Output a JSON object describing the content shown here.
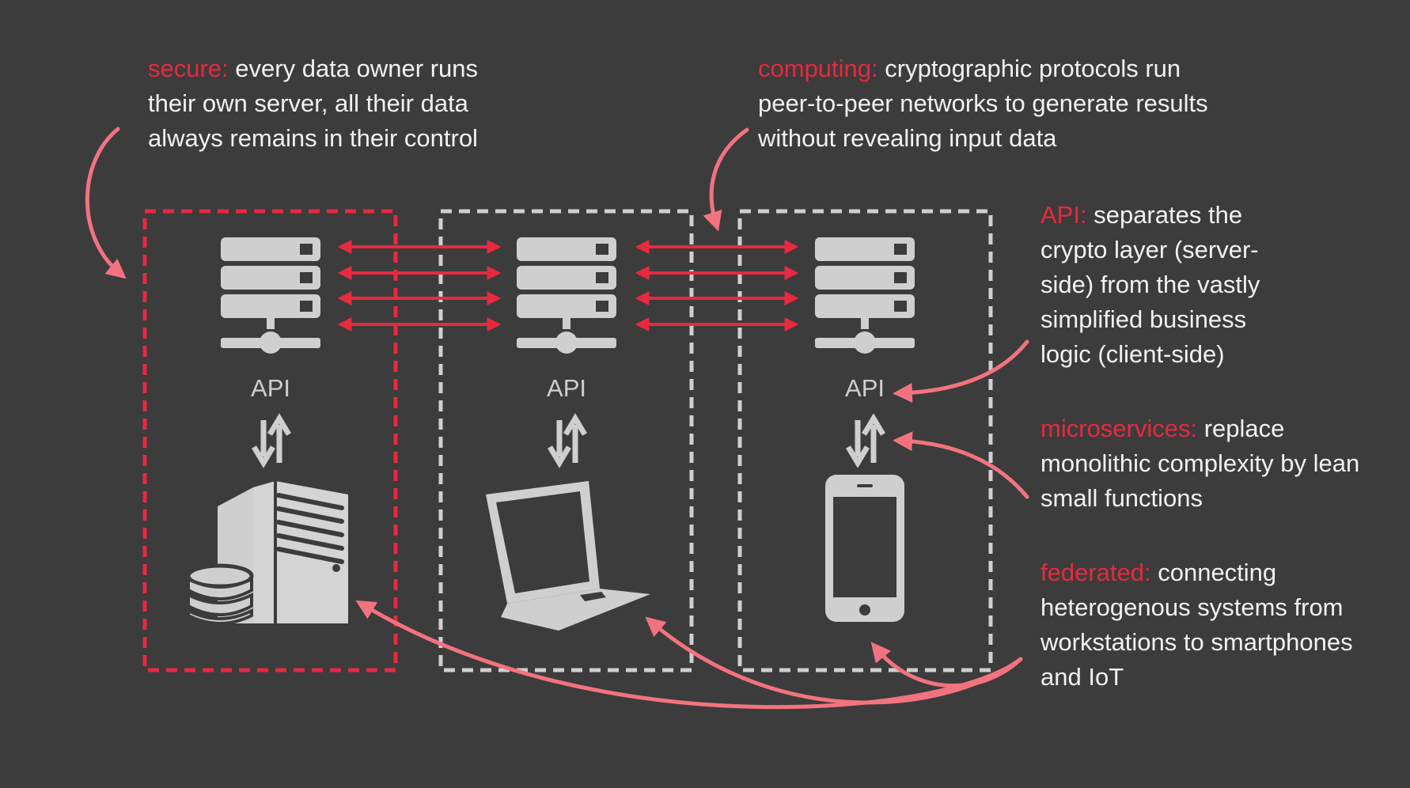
{
  "colors": {
    "background": "#3c3c3c",
    "accent": "#e8293f",
    "arrow_pink": "#f2737f",
    "icon_gray": "#cfcfcf",
    "dashed_gray": "#cfcfcf",
    "text": "#f2f2f2"
  },
  "annotations": {
    "secure": {
      "keyword": "secure:",
      "text": " every data owner runs their own server, all their data always remains in their control"
    },
    "computing": {
      "keyword": "computing:",
      "text": " cryptographic protocols run peer-to-peer networks to generate results without revealing input data"
    },
    "api": {
      "keyword": "API:",
      "text": " separates the crypto layer (server-side) from the vastly simplified business logic (client-side)"
    },
    "microservices": {
      "keyword": "microservices:",
      "text": " replace monolithic complexity by lean small functions"
    },
    "federated": {
      "keyword": "federated:",
      "text": " connecting heterogenous systems from workstations to smartphones and IoT"
    }
  },
  "nodes": [
    {
      "api_label": "API",
      "server_icon": "server-rack-icon",
      "client_icon": "workstation-database-icon"
    },
    {
      "api_label": "API",
      "server_icon": "server-rack-icon",
      "client_icon": "laptop-icon"
    },
    {
      "api_label": "API",
      "server_icon": "server-rack-icon",
      "client_icon": "smartphone-icon"
    }
  ]
}
